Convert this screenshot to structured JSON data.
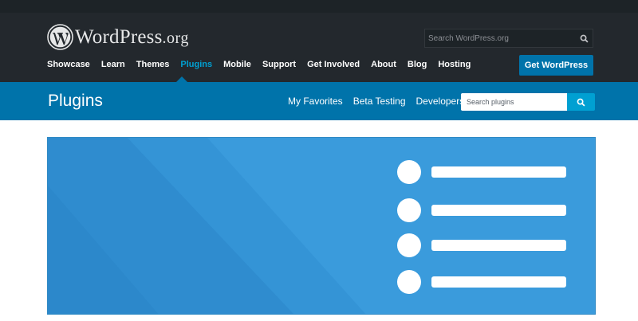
{
  "brand": {
    "logo_main": "WordPress",
    "logo_tld": ".org"
  },
  "global_search": {
    "placeholder": "Search WordPress.org"
  },
  "main_nav": {
    "items": [
      {
        "label": "Showcase",
        "active": false
      },
      {
        "label": "Learn",
        "active": false
      },
      {
        "label": "Themes",
        "active": false
      },
      {
        "label": "Plugins",
        "active": true
      },
      {
        "label": "Mobile",
        "active": false
      },
      {
        "label": "Support",
        "active": false
      },
      {
        "label": "Get Involved",
        "active": false
      },
      {
        "label": "About",
        "active": false
      },
      {
        "label": "Blog",
        "active": false
      },
      {
        "label": "Hosting",
        "active": false
      }
    ],
    "cta_label": "Get WordPress"
  },
  "plugins_header": {
    "title": "Plugins",
    "links": [
      "My Favorites",
      "Beta Testing",
      "Developers"
    ],
    "search_placeholder": "Search plugins"
  },
  "banner": {
    "feature_count": 4
  },
  "colors": {
    "header_bg": "#23282d",
    "accent": "#0073aa",
    "active_link": "#00a0d2",
    "banner_bg": "#3a9bdc"
  },
  "icons": {
    "logo": "wordpress-logo-icon",
    "search": "search-icon"
  }
}
